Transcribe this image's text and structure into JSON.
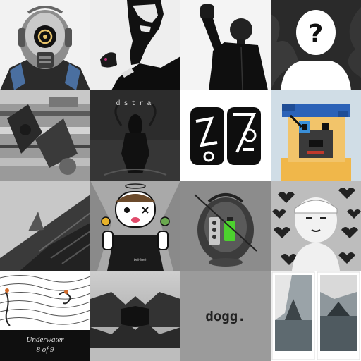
{
  "tiles": [
    {
      "subject": "robot-helmet-art"
    },
    {
      "subject": "ink-profile-portrait"
    },
    {
      "subject": "raised-fist-photo"
    },
    {
      "subject": "mystery-silhouette"
    },
    {
      "subject": "glitch-collage"
    },
    {
      "subject": "dstra-figure",
      "text": "dstra"
    },
    {
      "subject": "abstract-glyph-logo"
    },
    {
      "subject": "pixel-pug"
    },
    {
      "subject": "skyscraper-photo"
    },
    {
      "subject": "cartoon-peace-character",
      "badge_text": "bell-fresh"
    },
    {
      "subject": "surreal-sculpture"
    },
    {
      "subject": "clay-character-hearts"
    },
    {
      "subject": "underwater-sketch",
      "caption_line1": "Underwater",
      "caption_line2": "8 of 9"
    },
    {
      "subject": "mirrored-mountain"
    },
    {
      "subject": "dogg-text",
      "text": "dogg."
    },
    {
      "subject": "polaroid-photos"
    }
  ]
}
